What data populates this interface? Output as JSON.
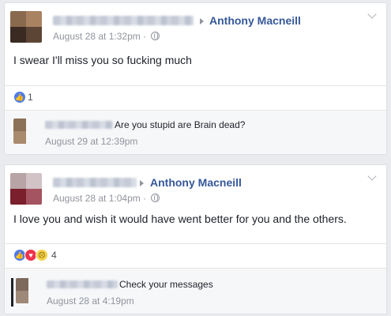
{
  "posts": [
    {
      "author": "Anthony Macneill",
      "timestamp": "August 28 at 1:32pm",
      "privacy_icon": "globe-icon",
      "text": "I swear I'll miss you so fucking much",
      "reaction_count": "1",
      "reactions": [
        "like"
      ],
      "comment": {
        "text": "Are you stupid are Brain dead?",
        "timestamp": "August 29 at 12:39pm"
      }
    },
    {
      "author": "Anthony Macneill",
      "timestamp": "August 28 at 1:04pm",
      "privacy_icon": "globe-icon",
      "text": "I love you and wish it would have went better for you and the others.",
      "reaction_count": "4",
      "reactions": [
        "like",
        "love",
        "sad"
      ],
      "comment": {
        "text": "Check your messages",
        "timestamp": "August 28 at 4:19pm"
      }
    }
  ],
  "colors": {
    "link": "#365899",
    "meta": "#90949c",
    "background": "#e9ebee"
  }
}
